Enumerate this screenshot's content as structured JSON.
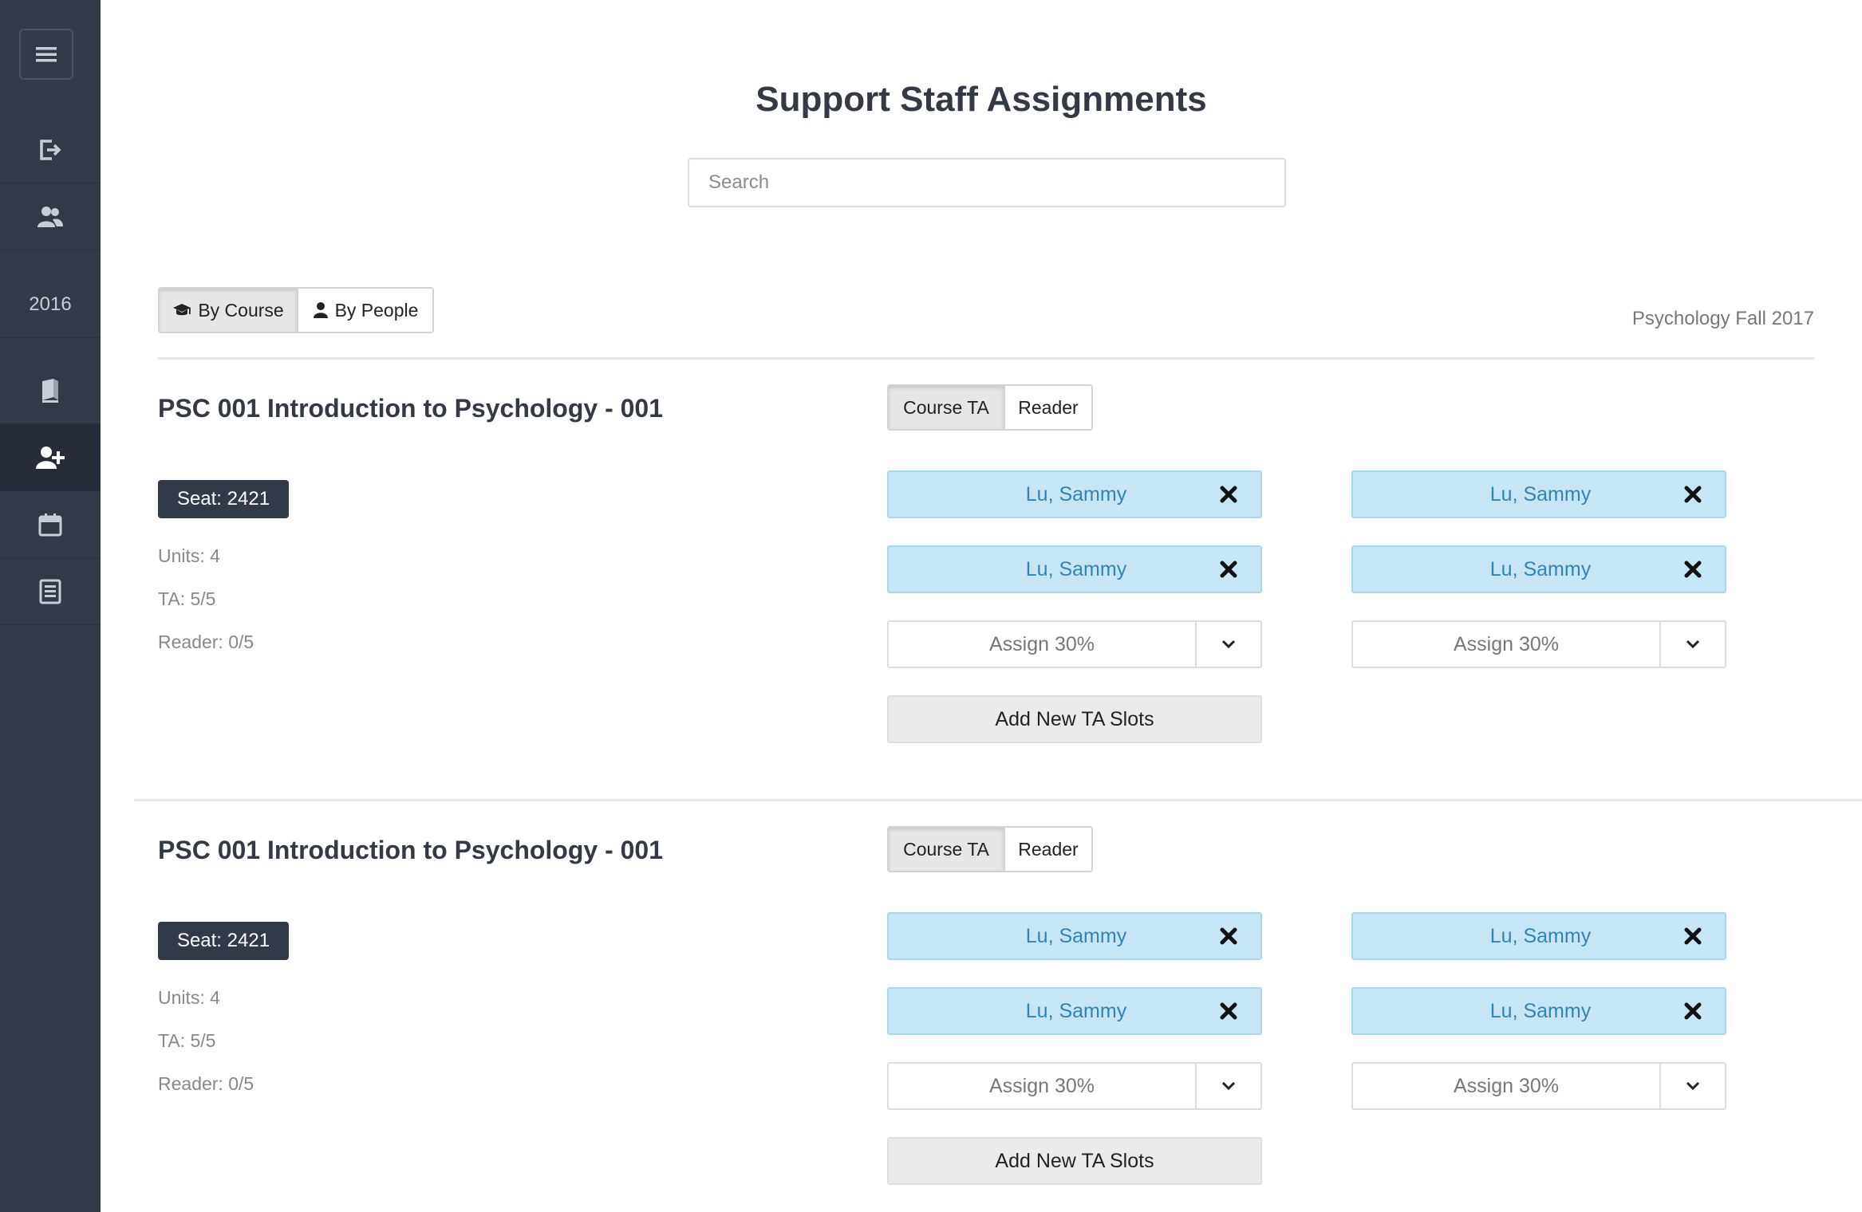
{
  "sidebar": {
    "year": "2016",
    "icons": [
      "menu-icon",
      "sign-out-icon",
      "users-icon",
      "book-icon",
      "add-user-icon",
      "calendar-icon",
      "report-icon"
    ]
  },
  "header": {
    "title": "Support Staff Assignments",
    "search_placeholder": "Search"
  },
  "view_toggle": {
    "by_course": "By Course",
    "by_people": "By People"
  },
  "term_label": "Psychology Fall 2017",
  "colors": {
    "sidebar": "#323a48",
    "assigned_bg": "#c6e6f5",
    "assigned_text": "#2e86b8"
  },
  "courses": [
    {
      "title": "PSC 001 Introduction to Psychology - 001",
      "role_tabs": [
        "Course TA",
        "Reader"
      ],
      "seat": "Seat: 2421",
      "units": "Units: 4",
      "ta": "TA: 5/5",
      "reader": "Reader: 0/5",
      "assigned": [
        "Lu, Sammy",
        "Lu, Sammy",
        "Lu, Sammy",
        "Lu, Sammy"
      ],
      "assign_options": [
        "Assign 30%",
        "Assign 30%"
      ],
      "add_button": "Add New TA Slots"
    },
    {
      "title": "PSC 001 Introduction to Psychology - 001",
      "role_tabs": [
        "Course TA",
        "Reader"
      ],
      "seat": "Seat: 2421",
      "units": "Units: 4",
      "ta": "TA: 5/5",
      "reader": "Reader: 0/5",
      "assigned": [
        "Lu, Sammy",
        "Lu, Sammy",
        "Lu, Sammy",
        "Lu, Sammy"
      ],
      "assign_options": [
        "Assign 30%",
        "Assign 30%"
      ],
      "add_button": "Add New TA Slots"
    }
  ]
}
